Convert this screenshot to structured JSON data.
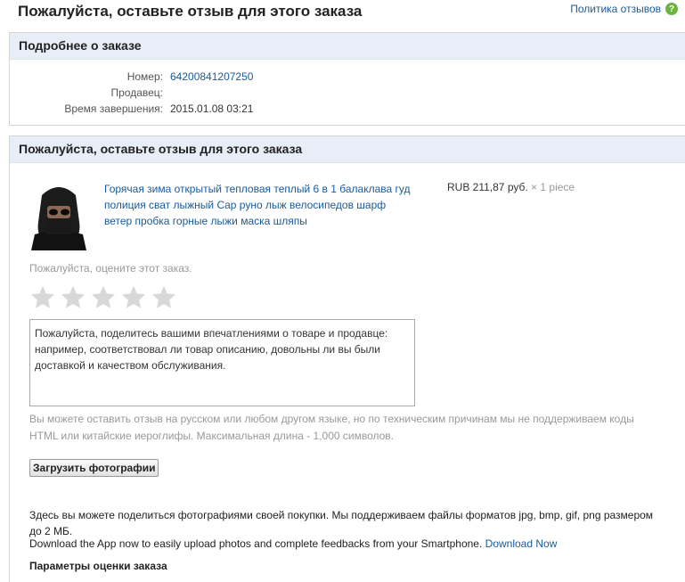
{
  "page": {
    "title": "Пожалуйста, оставьте отзыв для этого заказа",
    "policy_link": "Политика отзывов",
    "help_icon": "?"
  },
  "details": {
    "header": "Подробнее о заказе",
    "number_label": "Номер:",
    "number_value": "64200841207250",
    "seller_label": "Продавец:",
    "seller_value": "",
    "completed_label": "Время завершения:",
    "completed_value": "2015.01.08 03:21"
  },
  "feedback": {
    "header": "Пожалуйста, оставьте отзыв для этого заказа",
    "product_title": "Горячая зима открытый тепловая теплый 6 в 1 балаклава гуд полиция сват лыжный Cap руно лыж велосипедов шарф ветер пробка горные лыжи маска шляпы",
    "price": "RUB 211,87 руб.",
    "quantity": "× 1 piece",
    "rate_label": "Пожалуйста, оцените этот заказ.",
    "stars_filled": 0,
    "stars_total": 5,
    "review_placeholder": "Пожалуйста, поделитесь вашими впечатлениями о товаре и продавце: например, соответствовал ли товар описанию, довольны ли вы были доставкой и качеством обслуживания.",
    "language_note": "Вы можете оставить отзыв на русском или любом другом языке, но по техническим причинам мы не поддерживаем коды HTML или китайские иероглифы. Максимальная длина - 1,000 символов.",
    "upload_button": "Загрузить фотографии",
    "photo_note": "Здесь вы можете поделиться фотографиями своей покупки. Мы поддерживаем файлы форматов jpg, bmp, gif, png размером до 2 МБ.",
    "app_note": "Download the App now to easily upload photos and complete feedbacks from your Smartphone.",
    "app_link": "Download Now",
    "params_title": "Параметры оценки заказа"
  },
  "colors": {
    "header_bg": "#e8eef7",
    "link": "#1a5a9a",
    "star_empty": "#d8d8d8",
    "help_icon": "#6db33f"
  }
}
